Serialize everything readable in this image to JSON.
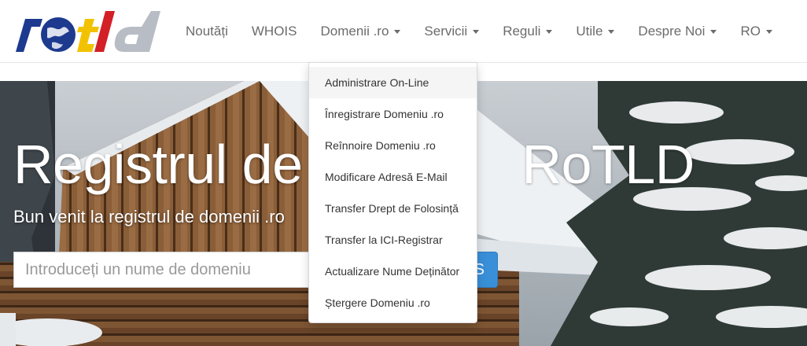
{
  "brand": {
    "logo_text": "rotld"
  },
  "nav": {
    "items": [
      {
        "label": "Noutăți",
        "has_caret": false
      },
      {
        "label": "WHOIS",
        "has_caret": false
      },
      {
        "label": "Domenii .ro",
        "has_caret": true
      },
      {
        "label": "Servicii",
        "has_caret": true
      },
      {
        "label": "Reguli",
        "has_caret": true
      },
      {
        "label": "Utile",
        "has_caret": true
      },
      {
        "label": "Despre Noi",
        "has_caret": true
      },
      {
        "label": "RO",
        "has_caret": true
      }
    ]
  },
  "hero": {
    "title_left": "Registrul de D",
    "title_right": "RoTLD",
    "subtitle": "Bun venit la registrul de domenii .ro",
    "search_placeholder": "Introduceți un nume de domeniu",
    "search_button_label": "S"
  },
  "dropdown": {
    "items": [
      "Administrare On-Line",
      "Înregistrare Domeniu .ro",
      "Reînnoire Domeniu .ro",
      "Modificare Adresă E-Mail",
      "Transfer Drept de Folosință",
      "Transfer la ICI-Registrar",
      "Actualizare Nume Deținător",
      "Ștergere Domeniu .ro"
    ]
  },
  "colors": {
    "nav_text": "#6b6b6b",
    "logo_blue": "#1d3a8f",
    "logo_yellow": "#f2c200",
    "logo_red": "#d31f26",
    "button_blue": "#3a8fd9"
  }
}
